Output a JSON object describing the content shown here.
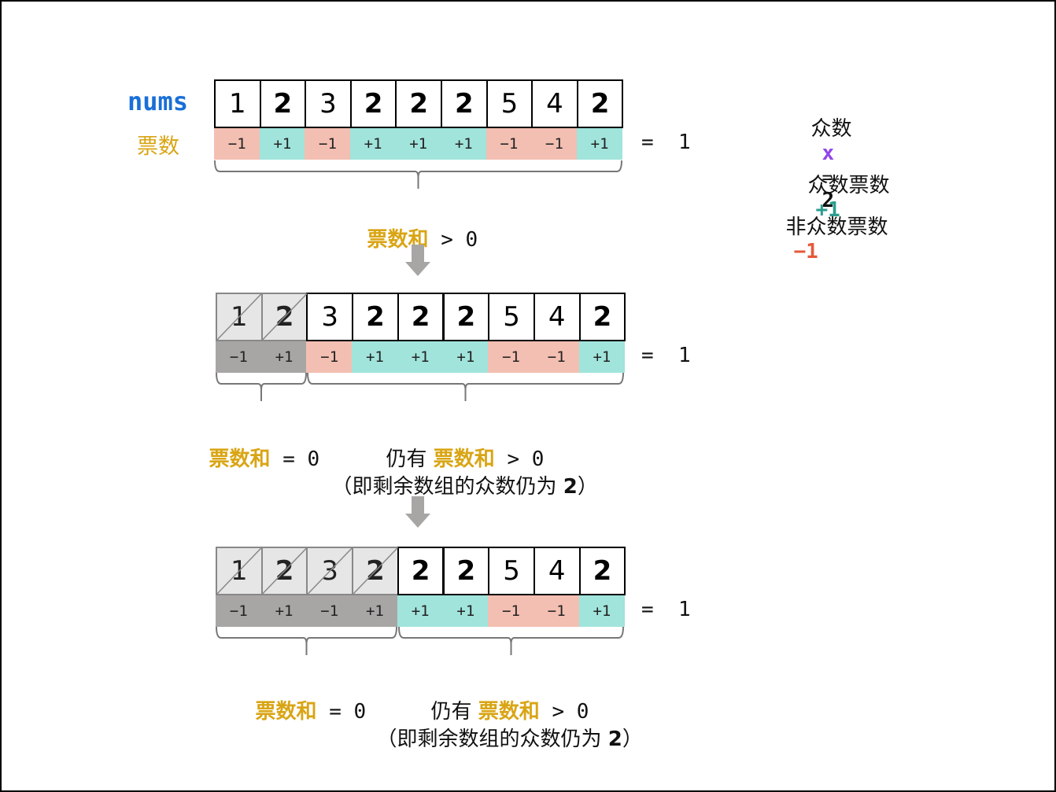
{
  "colors": {
    "minus": "#f3bfb2",
    "plus": "#a1e4dc",
    "discarded": "#a8a6a5",
    "gold": "#d9a514",
    "blue": "#1a6fd8",
    "purple": "#9146e8",
    "teal": "#2a9d8f",
    "red": "#e45a3a",
    "arrow": "#a8a6a5"
  },
  "labels": {
    "nums": "nums",
    "votes": "票数",
    "equals_result": "=  1"
  },
  "legend": {
    "mode_label": "众数",
    "x": "x",
    "eq": "=",
    "mode_value": "2",
    "mode_vote_label": "众数票数",
    "mode_vote_value": "+1",
    "non_mode_vote_label": "非众数票数",
    "non_mode_vote_value": "−1"
  },
  "rows": [
    {
      "nums": [
        "1",
        "2",
        "3",
        "2",
        "2",
        "2",
        "5",
        "4",
        "2"
      ],
      "votes": [
        "−1",
        "+1",
        "−1",
        "+1",
        "+1",
        "+1",
        "−1",
        "−1",
        "+1"
      ],
      "discarded_count": 0,
      "sum_result": "=  1"
    },
    {
      "nums": [
        "1",
        "2",
        "3",
        "2",
        "2",
        "2",
        "5",
        "4",
        "2"
      ],
      "votes": [
        "−1",
        "+1",
        "−1",
        "+1",
        "+1",
        "+1",
        "−1",
        "−1",
        "+1"
      ],
      "discarded_count": 2,
      "sum_result": "=  1"
    },
    {
      "nums": [
        "1",
        "2",
        "3",
        "2",
        "2",
        "2",
        "5",
        "4",
        "2"
      ],
      "votes": [
        "−1",
        "+1",
        "−1",
        "+1",
        "+1",
        "+1",
        "−1",
        "−1",
        "+1"
      ],
      "discarded_count": 4,
      "sum_result": "=  1"
    }
  ],
  "captions": {
    "step1": {
      "gold": "票数和",
      "rest": " > 0"
    },
    "step2": {
      "left_gold": "票数和",
      "left_rest": " = 0",
      "still": "仍有 ",
      "right_gold": "票数和",
      "right_rest": " > 0",
      "note_open": "（即剩余数组的众数仍为 ",
      "note_value": "2",
      "note_close": "）"
    },
    "step3": {
      "left_gold": "票数和",
      "left_rest": " = 0",
      "still": "仍有 ",
      "right_gold": "票数和",
      "right_rest": " > 0",
      "note_open": "（即剩余数组的众数仍为 ",
      "note_value": "2",
      "note_close": "）"
    }
  }
}
